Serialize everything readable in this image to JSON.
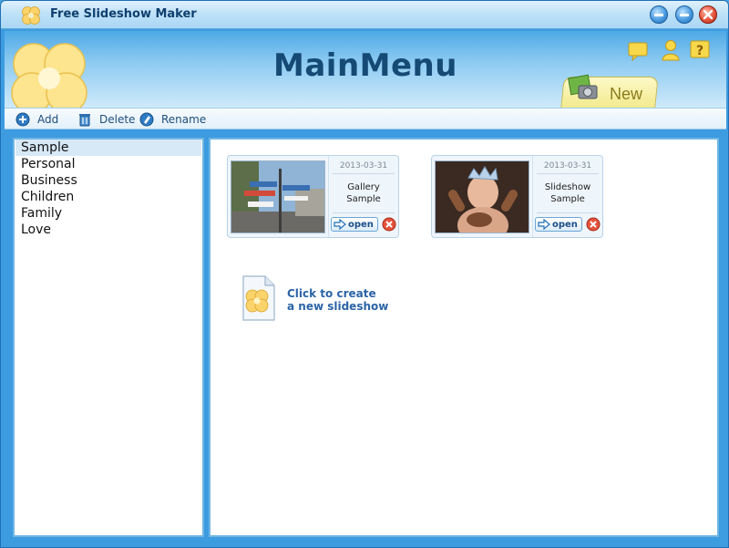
{
  "window": {
    "title": "Free Slideshow Maker"
  },
  "header": {
    "title": "MainMenu",
    "new_label": "New",
    "icons": [
      "comment-icon",
      "user-icon",
      "help-icon"
    ]
  },
  "toolbar": {
    "add_label": "Add",
    "delete_label": "Delete",
    "rename_label": "Rename"
  },
  "categories": {
    "items": [
      {
        "label": "Sample",
        "selected": true
      },
      {
        "label": "Personal",
        "selected": false
      },
      {
        "label": "Business",
        "selected": false
      },
      {
        "label": "Children",
        "selected": false
      },
      {
        "label": "Family",
        "selected": false
      },
      {
        "label": "Love",
        "selected": false
      }
    ]
  },
  "slideshows": [
    {
      "date": "2013-03-31",
      "name_line1": "Gallery",
      "name_line2": "Sample",
      "open_label": "open"
    },
    {
      "date": "2013-03-31",
      "name_line1": "Slideshow",
      "name_line2": "Sample",
      "open_label": "open"
    }
  ],
  "create": {
    "line1": "Click to create",
    "line2": "a new slideshow"
  },
  "colors": {
    "frame": "#3d9be0",
    "title_text": "#154a75",
    "link_blue": "#2c64a6",
    "tab_yellow": "#f2ea8e"
  }
}
